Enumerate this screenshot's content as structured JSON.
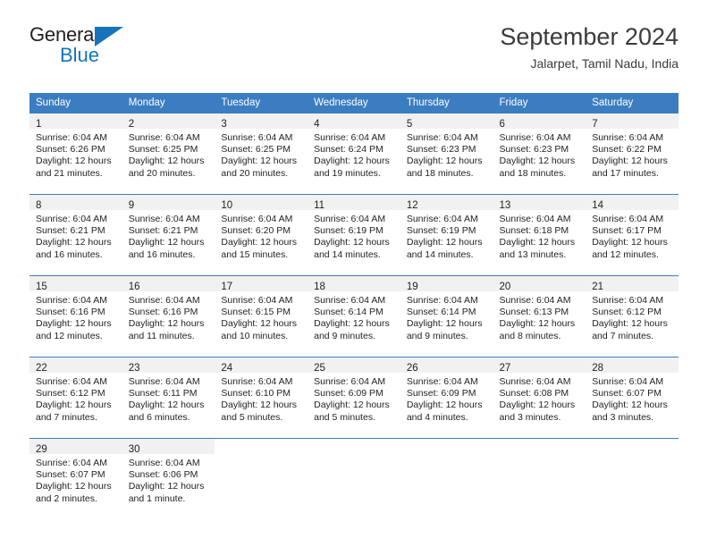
{
  "logo": {
    "line1": "General",
    "line2": "Blue",
    "triangle_icon": "triangle-icon",
    "brand_blue": "#1574bb"
  },
  "header": {
    "title": "September 2024",
    "subtitle": "Jalarpet, Tamil Nadu, India"
  },
  "theme": {
    "header_blue": "#3b7dc0",
    "date_band_gray": "#f1f1f1",
    "text": "#231f20"
  },
  "calendar": {
    "weekday_headers": [
      "Sunday",
      "Monday",
      "Tuesday",
      "Wednesday",
      "Thursday",
      "Friday",
      "Saturday"
    ],
    "weeks": [
      [
        {
          "day": "1",
          "sunrise": "Sunrise: 6:04 AM",
          "sunset": "Sunset: 6:26 PM",
          "daylight1": "Daylight: 12 hours",
          "daylight2": "and 21 minutes."
        },
        {
          "day": "2",
          "sunrise": "Sunrise: 6:04 AM",
          "sunset": "Sunset: 6:25 PM",
          "daylight1": "Daylight: 12 hours",
          "daylight2": "and 20 minutes."
        },
        {
          "day": "3",
          "sunrise": "Sunrise: 6:04 AM",
          "sunset": "Sunset: 6:25 PM",
          "daylight1": "Daylight: 12 hours",
          "daylight2": "and 20 minutes."
        },
        {
          "day": "4",
          "sunrise": "Sunrise: 6:04 AM",
          "sunset": "Sunset: 6:24 PM",
          "daylight1": "Daylight: 12 hours",
          "daylight2": "and 19 minutes."
        },
        {
          "day": "5",
          "sunrise": "Sunrise: 6:04 AM",
          "sunset": "Sunset: 6:23 PM",
          "daylight1": "Daylight: 12 hours",
          "daylight2": "and 18 minutes."
        },
        {
          "day": "6",
          "sunrise": "Sunrise: 6:04 AM",
          "sunset": "Sunset: 6:23 PM",
          "daylight1": "Daylight: 12 hours",
          "daylight2": "and 18 minutes."
        },
        {
          "day": "7",
          "sunrise": "Sunrise: 6:04 AM",
          "sunset": "Sunset: 6:22 PM",
          "daylight1": "Daylight: 12 hours",
          "daylight2": "and 17 minutes."
        }
      ],
      [
        {
          "day": "8",
          "sunrise": "Sunrise: 6:04 AM",
          "sunset": "Sunset: 6:21 PM",
          "daylight1": "Daylight: 12 hours",
          "daylight2": "and 16 minutes."
        },
        {
          "day": "9",
          "sunrise": "Sunrise: 6:04 AM",
          "sunset": "Sunset: 6:21 PM",
          "daylight1": "Daylight: 12 hours",
          "daylight2": "and 16 minutes."
        },
        {
          "day": "10",
          "sunrise": "Sunrise: 6:04 AM",
          "sunset": "Sunset: 6:20 PM",
          "daylight1": "Daylight: 12 hours",
          "daylight2": "and 15 minutes."
        },
        {
          "day": "11",
          "sunrise": "Sunrise: 6:04 AM",
          "sunset": "Sunset: 6:19 PM",
          "daylight1": "Daylight: 12 hours",
          "daylight2": "and 14 minutes."
        },
        {
          "day": "12",
          "sunrise": "Sunrise: 6:04 AM",
          "sunset": "Sunset: 6:19 PM",
          "daylight1": "Daylight: 12 hours",
          "daylight2": "and 14 minutes."
        },
        {
          "day": "13",
          "sunrise": "Sunrise: 6:04 AM",
          "sunset": "Sunset: 6:18 PM",
          "daylight1": "Daylight: 12 hours",
          "daylight2": "and 13 minutes."
        },
        {
          "day": "14",
          "sunrise": "Sunrise: 6:04 AM",
          "sunset": "Sunset: 6:17 PM",
          "daylight1": "Daylight: 12 hours",
          "daylight2": "and 12 minutes."
        }
      ],
      [
        {
          "day": "15",
          "sunrise": "Sunrise: 6:04 AM",
          "sunset": "Sunset: 6:16 PM",
          "daylight1": "Daylight: 12 hours",
          "daylight2": "and 12 minutes."
        },
        {
          "day": "16",
          "sunrise": "Sunrise: 6:04 AM",
          "sunset": "Sunset: 6:16 PM",
          "daylight1": "Daylight: 12 hours",
          "daylight2": "and 11 minutes."
        },
        {
          "day": "17",
          "sunrise": "Sunrise: 6:04 AM",
          "sunset": "Sunset: 6:15 PM",
          "daylight1": "Daylight: 12 hours",
          "daylight2": "and 10 minutes."
        },
        {
          "day": "18",
          "sunrise": "Sunrise: 6:04 AM",
          "sunset": "Sunset: 6:14 PM",
          "daylight1": "Daylight: 12 hours",
          "daylight2": "and 9 minutes."
        },
        {
          "day": "19",
          "sunrise": "Sunrise: 6:04 AM",
          "sunset": "Sunset: 6:14 PM",
          "daylight1": "Daylight: 12 hours",
          "daylight2": "and 9 minutes."
        },
        {
          "day": "20",
          "sunrise": "Sunrise: 6:04 AM",
          "sunset": "Sunset: 6:13 PM",
          "daylight1": "Daylight: 12 hours",
          "daylight2": "and 8 minutes."
        },
        {
          "day": "21",
          "sunrise": "Sunrise: 6:04 AM",
          "sunset": "Sunset: 6:12 PM",
          "daylight1": "Daylight: 12 hours",
          "daylight2": "and 7 minutes."
        }
      ],
      [
        {
          "day": "22",
          "sunrise": "Sunrise: 6:04 AM",
          "sunset": "Sunset: 6:12 PM",
          "daylight1": "Daylight: 12 hours",
          "daylight2": "and 7 minutes."
        },
        {
          "day": "23",
          "sunrise": "Sunrise: 6:04 AM",
          "sunset": "Sunset: 6:11 PM",
          "daylight1": "Daylight: 12 hours",
          "daylight2": "and 6 minutes."
        },
        {
          "day": "24",
          "sunrise": "Sunrise: 6:04 AM",
          "sunset": "Sunset: 6:10 PM",
          "daylight1": "Daylight: 12 hours",
          "daylight2": "and 5 minutes."
        },
        {
          "day": "25",
          "sunrise": "Sunrise: 6:04 AM",
          "sunset": "Sunset: 6:09 PM",
          "daylight1": "Daylight: 12 hours",
          "daylight2": "and 5 minutes."
        },
        {
          "day": "26",
          "sunrise": "Sunrise: 6:04 AM",
          "sunset": "Sunset: 6:09 PM",
          "daylight1": "Daylight: 12 hours",
          "daylight2": "and 4 minutes."
        },
        {
          "day": "27",
          "sunrise": "Sunrise: 6:04 AM",
          "sunset": "Sunset: 6:08 PM",
          "daylight1": "Daylight: 12 hours",
          "daylight2": "and 3 minutes."
        },
        {
          "day": "28",
          "sunrise": "Sunrise: 6:04 AM",
          "sunset": "Sunset: 6:07 PM",
          "daylight1": "Daylight: 12 hours",
          "daylight2": "and 3 minutes."
        }
      ],
      [
        {
          "day": "29",
          "sunrise": "Sunrise: 6:04 AM",
          "sunset": "Sunset: 6:07 PM",
          "daylight1": "Daylight: 12 hours",
          "daylight2": "and 2 minutes."
        },
        {
          "day": "30",
          "sunrise": "Sunrise: 6:04 AM",
          "sunset": "Sunset: 6:06 PM",
          "daylight1": "Daylight: 12 hours",
          "daylight2": "and 1 minute."
        },
        {
          "day": "",
          "sunrise": "",
          "sunset": "",
          "daylight1": "",
          "daylight2": ""
        },
        {
          "day": "",
          "sunrise": "",
          "sunset": "",
          "daylight1": "",
          "daylight2": ""
        },
        {
          "day": "",
          "sunrise": "",
          "sunset": "",
          "daylight1": "",
          "daylight2": ""
        },
        {
          "day": "",
          "sunrise": "",
          "sunset": "",
          "daylight1": "",
          "daylight2": ""
        },
        {
          "day": "",
          "sunrise": "",
          "sunset": "",
          "daylight1": "",
          "daylight2": ""
        }
      ]
    ]
  }
}
